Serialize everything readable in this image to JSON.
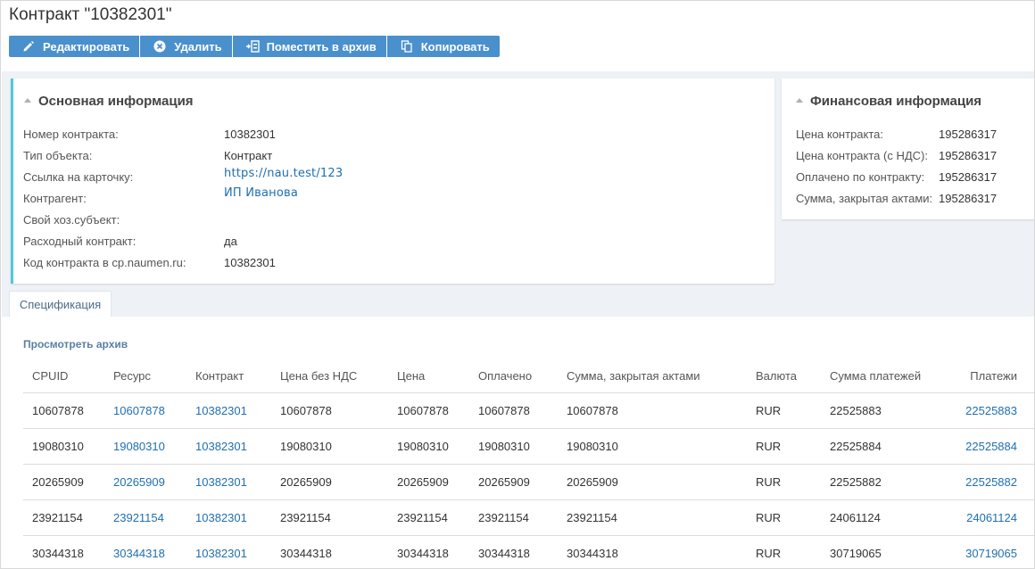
{
  "header": {
    "title": "Контракт \"10382301\""
  },
  "toolbar": {
    "edit": "Редактировать",
    "delete": "Удалить",
    "archive": "Поместить в архив",
    "copy": "Копировать"
  },
  "main_info": {
    "title": "Основная информация",
    "fields": [
      {
        "label": "Номер контракта:",
        "value": "10382301"
      },
      {
        "label": "Тип объекта:",
        "value": "Контракт"
      },
      {
        "label": "Ссылка на карточку:",
        "value": "https://nau.test/123"
      },
      {
        "label": "Контрагент:",
        "value": "ИП Иванова"
      },
      {
        "label": "Свой хоз.субъект:",
        "value": ""
      },
      {
        "label": "Расходный контракт:",
        "value": "да"
      },
      {
        "label": "Код контракта в cp.naumen.ru:",
        "value": "10382301"
      }
    ]
  },
  "fin_info": {
    "title": "Финансовая информация",
    "fields": [
      {
        "label": "Цена контракта:",
        "value": "195286317"
      },
      {
        "label": "Цена контракта (с НДС):",
        "value": "195286317"
      },
      {
        "label": "Оплачено по контракту:",
        "value": "195286317"
      },
      {
        "label": "Сумма, закрытая актами:",
        "value": "195286317"
      }
    ]
  },
  "tabs": [
    {
      "label": "Спецификация"
    }
  ],
  "spec": {
    "archive_link": "Просмотреть архив",
    "columns": [
      "CPUID",
      "Ресурс",
      "Контракт",
      "Цена без НДС",
      "Цена",
      "Оплачено",
      "Сумма, закрытая актами",
      "Валюта",
      "Сумма платежей",
      "Платежи"
    ],
    "rows": [
      [
        "10607878",
        "10607878",
        "10382301",
        "10607878",
        "10607878",
        "10607878",
        "10607878",
        "RUR",
        "22525883",
        "22525883"
      ],
      [
        "19080310",
        "19080310",
        "10382301",
        "19080310",
        "19080310",
        "19080310",
        "19080310",
        "RUR",
        "22525884",
        "22525884"
      ],
      [
        "20265909",
        "20265909",
        "10382301",
        "20265909",
        "20265909",
        "20265909",
        "20265909",
        "RUR",
        "22525882",
        "22525882"
      ],
      [
        "23921154",
        "23921154",
        "10382301",
        "23921154",
        "23921154",
        "23921154",
        "23921154",
        "RUR",
        "24061124",
        "24061124"
      ],
      [
        "30344318",
        "30344318",
        "10382301",
        "30344318",
        "30344318",
        "30344318",
        "30344318",
        "RUR",
        "30719065",
        "30719065"
      ]
    ]
  }
}
